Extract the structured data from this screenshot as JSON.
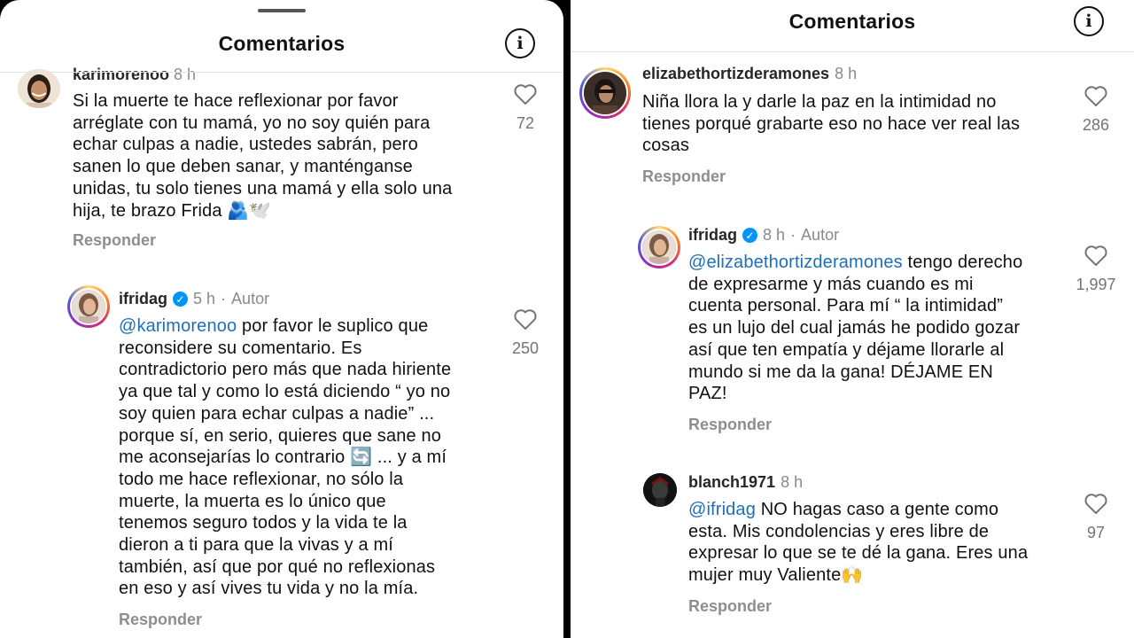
{
  "left": {
    "title": "Comentarios",
    "comments": [
      {
        "username": "karimorenoo",
        "time": "8 h",
        "text": "Si la muerte te hace reflexionar por favor\narréglate con tu mamá, yo no soy quién para\nechar culpas a nadie, ustedes sabrán, pero\nsanen lo que deben sanar, y manténganse\nunidas, tu solo tienes una mamá y ella solo una\nhija, te brazo Frida 🫂🕊️",
        "likes": "72",
        "reply": "Responder"
      },
      {
        "username": "ifridag",
        "time": "5 h",
        "author": "Autor",
        "mention": "@karimorenoo",
        "text_first": " por favor le suplico que",
        "text": "reconsidere su comentario. Es\ncontradictorio pero más que nada hiriente\nya que tal y como lo está diciendo “ yo no\nsoy quien para echar culpas a nadie” ...\nporque sí, en serio, quieres que sane no\nme aconsejarías lo contrario 🔄 ... y a mí\ntodo me hace reflexionar, no sólo la\nmuerte, la muerta es lo único que\ntenemos seguro todos y la vida te la\ndieron a ti para que la vivas y a mí\ntambién, así que por qué no reflexionas\nen eso y así vives tu vida y no la mía.",
        "likes": "250",
        "reply": "Responder"
      }
    ]
  },
  "right": {
    "title": "Comentarios",
    "comments": [
      {
        "username": "elizabethortizderamones",
        "time": "8 h",
        "text": "Niña llora la y darle la paz en la intimidad no\ntienes porqué grabarte eso no hace ver real las\ncosas",
        "likes": "286",
        "reply": "Responder"
      },
      {
        "username": "ifridag",
        "time": "8 h",
        "author": "Autor",
        "mention": "@elizabethortizderamones",
        "text_first": " tengo derecho",
        "text": "de expresarme y más cuando es mi\ncuenta personal. Para mí “ la intimidad”\nes un lujo del cual jamás he podido gozar\nasí que ten empatía y déjame llorarle al\nmundo si me da la gana! DÉJAME EN\nPAZ!",
        "likes": "1,997",
        "reply": "Responder"
      },
      {
        "username": "blanch1971",
        "time": "8 h",
        "mention": "@ifridag",
        "text_first": " NO hagas caso a gente como",
        "text": "esta. Mis condolencias y eres libre de\nexpresar lo que se te dé la gana. Eres una\nmujer muy Valiente🙌",
        "likes": "97",
        "reply": "Responder"
      }
    ]
  },
  "icons": {
    "info": "info-icon",
    "like": "heart-outline-icon",
    "verified": "verified-badge-icon"
  },
  "colors": {
    "mention": "#1f6fb8",
    "muted": "#8a8a8a",
    "verified": "#0095f6"
  }
}
